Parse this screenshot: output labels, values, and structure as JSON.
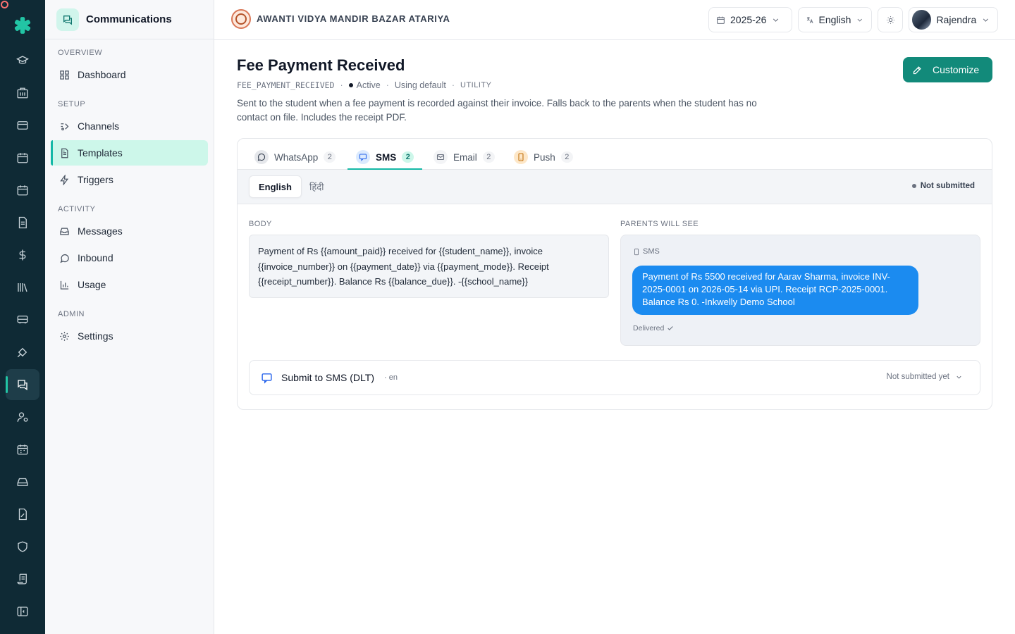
{
  "app": {
    "section_title": "Communications",
    "school_name": "AWANTI VIDYA MANDIR BAZAR ATARIYA",
    "session": "2025-26",
    "language": "English",
    "user_name": "Rajendra"
  },
  "rail_icons": [
    "graduation-cap-icon",
    "building-icon",
    "card-icon",
    "calendar-icon",
    "calendar-check-icon",
    "document-icon",
    "dollar-icon",
    "library-icon",
    "bus-icon",
    "pen-tool-icon",
    "messages-icon",
    "user-cog-icon",
    "calendar-grid-icon",
    "hard-drive-icon",
    "file-edit-icon",
    "shield-icon",
    "scroll-icon",
    "collapse-sidebar-icon"
  ],
  "sidebar": {
    "groups": {
      "overview": "OVERVIEW",
      "setup": "SETUP",
      "activity": "ACTIVITY",
      "admin": "ADMIN"
    },
    "items": {
      "dashboard": "Dashboard",
      "channels": "Channels",
      "templates": "Templates",
      "triggers": "Triggers",
      "messages": "Messages",
      "inbound": "Inbound",
      "usage": "Usage",
      "settings": "Settings"
    },
    "active": "templates"
  },
  "template": {
    "title": "Fee Payment Received",
    "code": "FEE_PAYMENT_RECEIVED",
    "status": "Active",
    "source": "Using default",
    "category": "UTILITY",
    "description": "Sent to the student when a fee payment is recorded against their invoice. Falls back to the parents when the student has no contact on file. Includes the receipt PDF.",
    "customize_label": "Customize"
  },
  "channel_tabs": [
    {
      "label": "WhatsApp",
      "count": "2",
      "icon": "whatsapp-icon",
      "color": "#e5e7eb"
    },
    {
      "label": "SMS",
      "count": "2",
      "icon": "sms-icon",
      "color": "#dbeafe"
    },
    {
      "label": "Email",
      "count": "2",
      "icon": "mail-icon",
      "color": "#f3f4f6"
    },
    {
      "label": "Push",
      "count": "2",
      "icon": "phone-icon",
      "color": "#fde7c8"
    }
  ],
  "active_channel": "SMS",
  "languages": [
    "English",
    "हिंदी"
  ],
  "active_language": "English",
  "submission_status": "Not submitted",
  "editor": {
    "body_label": "BODY",
    "body_text": "Payment of Rs {{amount_paid}} received for {{student_name}}, invoice {{invoice_number}} on {{payment_date}} via {{payment_mode}}. Receipt {{receipt_number}}. Balance Rs {{balance_due}}. -{{school_name}}",
    "preview_label": "PARENTS WILL SEE",
    "preview_channel": "SMS",
    "preview_text": "Payment of Rs 5500 received for Aarav Sharma, invoice INV-2025-0001 on 2026-05-14 via UPI. Receipt RCP-2025-0001. Balance Rs 0. -Inkwelly Demo School",
    "delivered_label": "Delivered"
  },
  "submit_panel": {
    "title": "Submit to SMS (DLT)",
    "lang_code": "· en",
    "status": "Not submitted yet"
  },
  "colors": {
    "rail_bg": "#0f2a35",
    "accent": "#14b8a6",
    "primary_button": "#128a7a",
    "sms_bubble": "#1b8bf0"
  }
}
